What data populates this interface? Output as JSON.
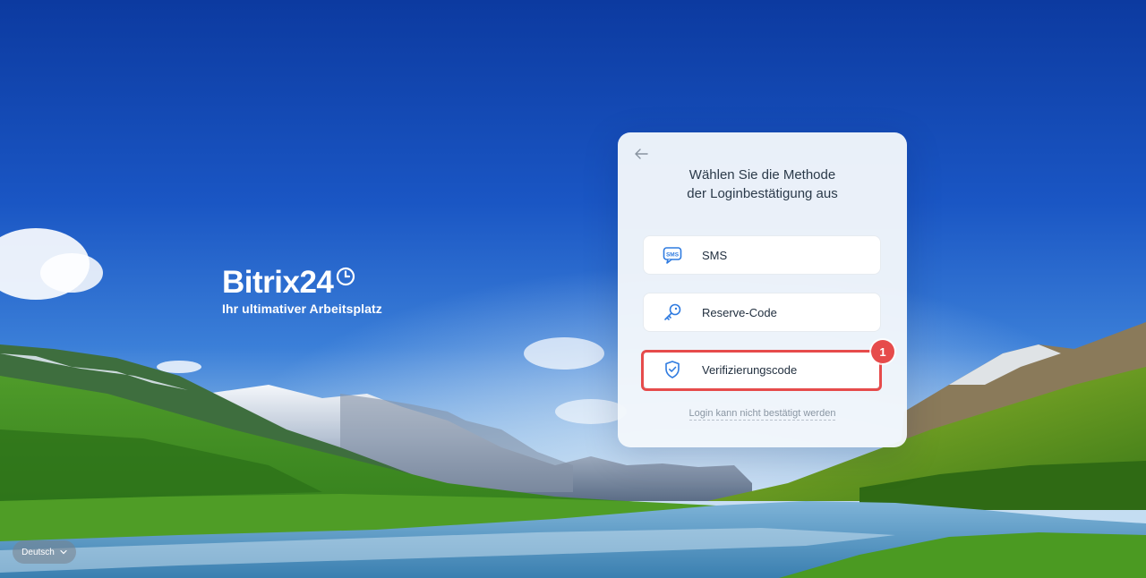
{
  "brand": {
    "name": "Bitrix24",
    "tagline": "Ihr ultimativer Arbeitsplatz"
  },
  "card": {
    "title_line1": "Wählen Sie die Methode",
    "title_line2": "der Loginbestätigung aus",
    "options": [
      {
        "label": "SMS",
        "icon": "sms-icon"
      },
      {
        "label": "Reserve-Code",
        "icon": "key-icon"
      },
      {
        "label": "Verifizierungscode",
        "icon": "shield-check-icon"
      }
    ],
    "cannot_confirm_link": "Login kann nicht bestätigt werden"
  },
  "annotation": {
    "badge_number": "1",
    "color": "#e64b4b"
  },
  "language": {
    "current": "Deutsch"
  },
  "colors": {
    "accent": "#2f7be0",
    "highlight": "#e64b4b"
  }
}
